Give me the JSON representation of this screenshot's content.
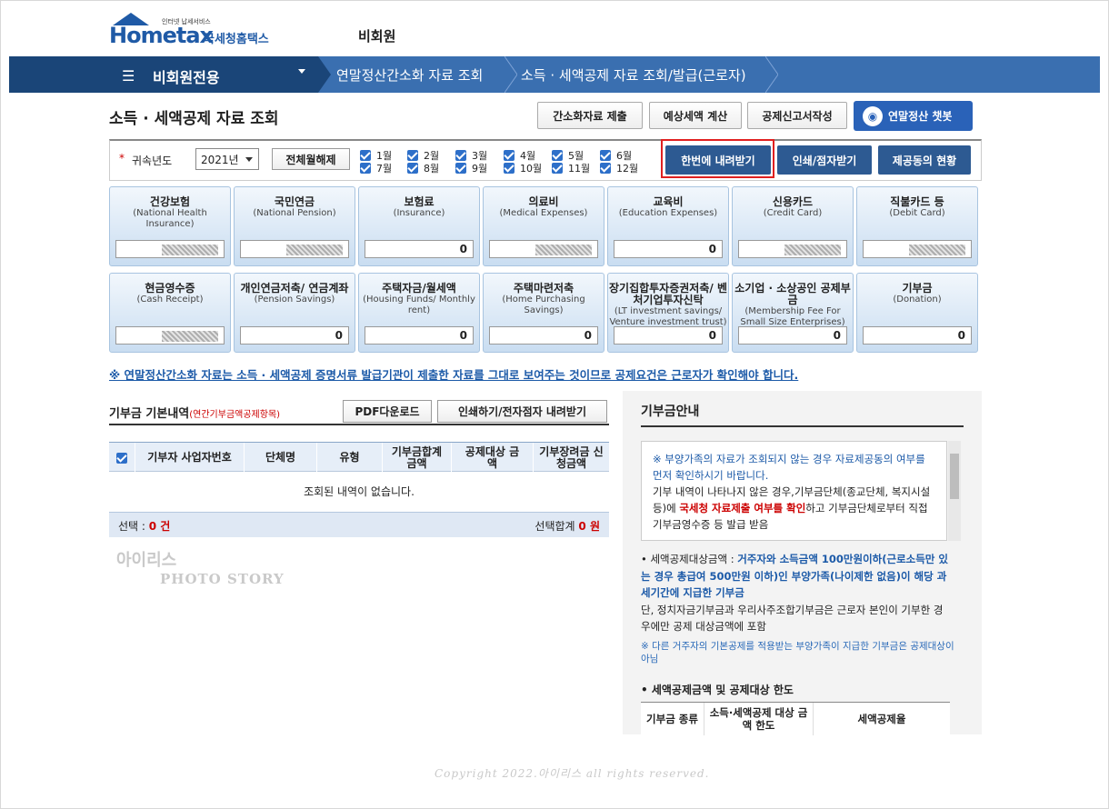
{
  "header": {
    "logo_small": "인터넷 납세서비스",
    "logo_text": "Hometax",
    "logo_kor": "국세청홈택스",
    "user_label": "비회원"
  },
  "nav": {
    "menu_label": "비회원전용",
    "crumbs": [
      "연말정산간소화 자료 조회",
      "소득 · 세액공제 자료 조회/발급(근로자)"
    ]
  },
  "page": {
    "title": "소득 · 세액공제 자료 조회",
    "buttons": [
      "간소화자료 제출",
      "예상세액 계산",
      "공제신고서작성"
    ],
    "chatbot_label": "연말정산 챗봇"
  },
  "filter": {
    "required_mark": "*",
    "year_label": "귀속년도",
    "year_value": "2021년",
    "clear_label": "전체월해제",
    "months": [
      "1월",
      "2월",
      "3월",
      "4월",
      "5월",
      "6월",
      "7월",
      "8월",
      "9월",
      "10월",
      "11월",
      "12월"
    ],
    "download_all_label": "한번에 내려받기",
    "print_label": "인쇄/점자받기",
    "provider_label": "제공동의 현황"
  },
  "cards": [
    {
      "k": "건강보험",
      "e": "(National Health Insurance)",
      "v": ""
    },
    {
      "k": "국민연금",
      "e": "(National Pension)",
      "v": ""
    },
    {
      "k": "보험료",
      "e": "(Insurance)",
      "v": "0"
    },
    {
      "k": "의료비",
      "e": "(Medical Expenses)",
      "v": ""
    },
    {
      "k": "교육비",
      "e": "(Education Expenses)",
      "v": "0"
    },
    {
      "k": "신용카드",
      "e": "(Credit Card)",
      "v": ""
    },
    {
      "k": "직불카드 등",
      "e": "(Debit Card)",
      "v": ""
    },
    {
      "k": "현금영수증",
      "e": "(Cash Receipt)",
      "v": ""
    },
    {
      "k": "개인연금저축/ 연금계좌",
      "e": "(Pension Savings)",
      "v": "0"
    },
    {
      "k": "주택자금/월세액",
      "e": "(Housing Funds/ Monthly rent)",
      "v": "0"
    },
    {
      "k": "주택마련저축",
      "e": "(Home Purchasing Savings)",
      "v": "0"
    },
    {
      "k": "장기집합투자증권저축/ 벤처기업투자신탁",
      "e": "(LT investment savings/ Venture investment trust)",
      "v": "0"
    },
    {
      "k": "소기업 · 소상공인 공제부금",
      "e": "(Membership Fee For Small Size Enterprises)",
      "v": "0"
    },
    {
      "k": "기부금",
      "e": "(Donation)",
      "v": "0"
    }
  ],
  "notice": "※ 연말정산간소화 자료는 소득 · 세액공제 증명서류 발급기관이 제출한 자료를 그대로 보여주는 것이므로 공제요건은 근로자가 확인해야 합니다.",
  "donation": {
    "title": "기부금 기본내역",
    "subtitle": "(연간기부금액공제항목)",
    "pdf_label": "PDF다운로드",
    "print_label": "인쇄하기/전자점자 내려받기",
    "columns": [
      "기부자",
      "사업자번호",
      "단체명",
      "유형",
      "기부금합계 금액",
      "공제대상 금액",
      "기부장려금 신청금액"
    ],
    "empty_text": "조회된 내역이 없습니다.",
    "selected_label": "선택 :",
    "selected_count": "0 건",
    "selected_total_label": "선택합계",
    "selected_total": "0 원"
  },
  "info": {
    "title": "기부금안내",
    "box_line1": "※ 부양가족의 자료가 조회되지 않는 경우 자료제공동의 여부를 먼저 확인하시기 바랍니다.",
    "box_line2a": "기부 내역이 나타나지 않은 경우,기부금단체(종교단체, 복지시설 등)에 ",
    "box_line2b": "국세청 자료제출 여부를 확인",
    "box_line2c": "하고 기부금단체로부터 직접 기부금영수증 등 발급 받음",
    "text_a": "• 세액공제대상금액 : ",
    "text_b": "거주자와 소득금액 100만원이하(근로소득만 있는 경우 총급여 500만원 이하)인 부양가족(나이제한 없음)이 해당 과세기간에 지급한 기부금",
    "text_c": "단, 정치자금기부금과 우리사주조합기부금은 근로자 본인이 기부한 경우에만 공제 대상금액에 포함",
    "note": "※ 다른 거주자의 기본공제를 적용받는 부양가족이 지급한 기부금은 공제대상이 아님",
    "sub_head": "• 세액공제금액 및 공제대상 한도",
    "sub_cols": [
      "기부금 종류",
      "소득·세액공제 대상 금액 한도",
      "세액공제율"
    ]
  },
  "watermark": {
    "line1": "아이리스",
    "line2": "PHOTO STORY",
    "copyright": "Copyright 2022.아이리스 all rights reserved."
  }
}
